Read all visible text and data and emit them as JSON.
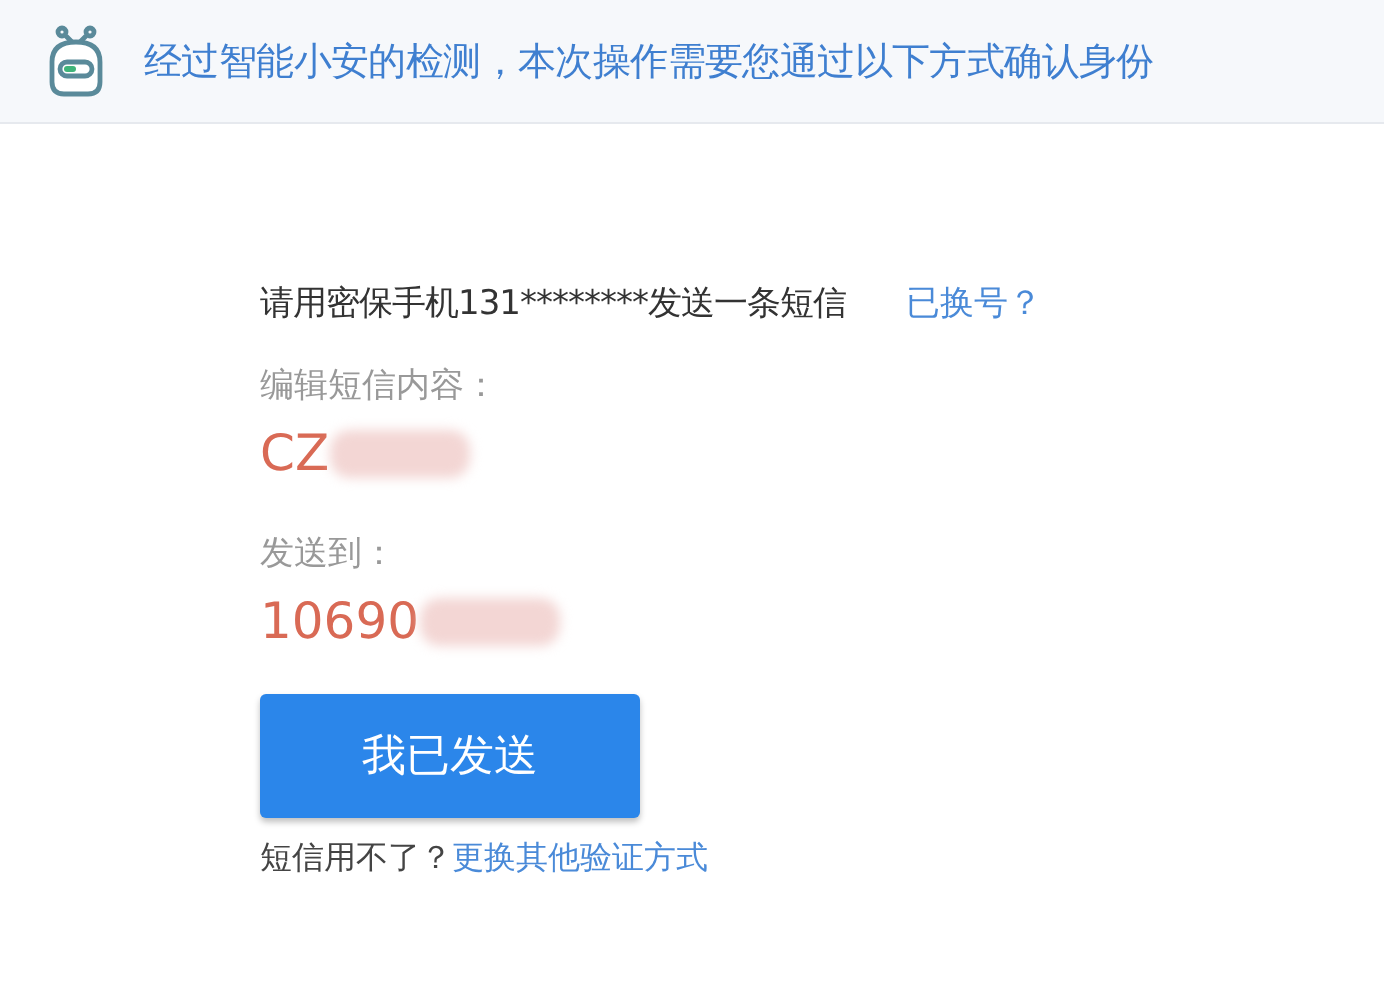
{
  "header": {
    "title": "经过智能小安的检测，本次操作需要您通过以下方式确认身份"
  },
  "instruction": {
    "text": "请用密保手机131********发送一条短信",
    "link": "已换号？"
  },
  "fields": [
    {
      "label": "编辑短信内容：",
      "value": "CZ"
    },
    {
      "label": "发送到：",
      "value": "10690"
    }
  ],
  "send_button": "我已发送",
  "footer": {
    "text": "短信用不了？",
    "link": "更换其他验证方式"
  }
}
